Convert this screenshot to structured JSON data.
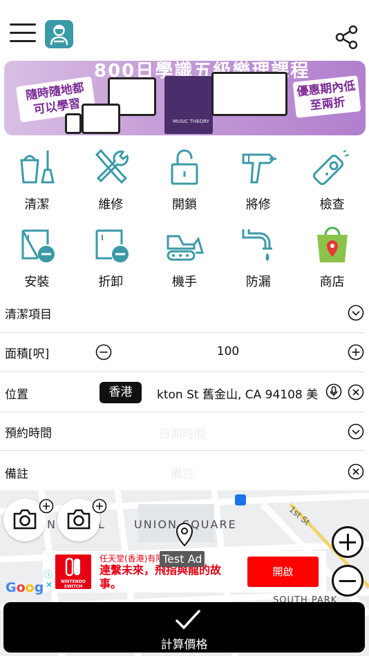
{
  "header": {
    "menu_icon": "hamburger-icon",
    "logo_icon": "worker-logo-icon",
    "share_icon": "share-icon"
  },
  "banner": {
    "title_partial": "800日學識五級樂理課程",
    "left_badge": "隨時隨地都可以學習",
    "right_badge": "優惠期內低至兩折",
    "book_text": "MUSIC THEORY"
  },
  "services": [
    {
      "label": "清潔",
      "icon": "cleaning-icon"
    },
    {
      "label": "維修",
      "icon": "repair-tools-icon"
    },
    {
      "label": "開鎖",
      "icon": "unlock-icon"
    },
    {
      "label": "將修",
      "icon": "drill-icon"
    },
    {
      "label": "檢查",
      "icon": "inspection-device-icon"
    },
    {
      "label": "安裝",
      "icon": "install-box-icon"
    },
    {
      "label": "折卸",
      "icon": "remove-box-icon"
    },
    {
      "label": "機手",
      "icon": "excavator-icon"
    },
    {
      "label": "防漏",
      "icon": "leaking-pipe-icon"
    },
    {
      "label": "商店",
      "icon": "shop-bag-icon"
    }
  ],
  "form": {
    "cleaning_items_label": "清潔項目",
    "area_label": "面積[呎]",
    "area_value": "100",
    "location_label": "位置",
    "region_tag": "香港",
    "address": "kton St 舊金山, CA  94108 美",
    "booking_label": "預約時間",
    "booking_placeholder": "日期時間",
    "notes_label": "備註",
    "notes_placeholder": "備註"
  },
  "map": {
    "area_label": "UNION SQUARE",
    "street_label": "1st St",
    "area_label_2": "SOUTH PARK",
    "partial_label_left": "N",
    "partial_label_left_2": "L",
    "marker_tooltip": "Test Ad",
    "attribution": "Google"
  },
  "ad": {
    "brand": "任天堂(香港)有限",
    "headline": "連繫未來，飛指與龍的故事。",
    "button": "開啟",
    "logo_text": "NINTENDO SWITCH",
    "info_glyph": "ⓘ",
    "close_glyph": "✕"
  },
  "footer": {
    "calculate_label": "計算價格"
  },
  "colors": {
    "accent": "#3a9aa8",
    "ad_red": "#e60012"
  }
}
